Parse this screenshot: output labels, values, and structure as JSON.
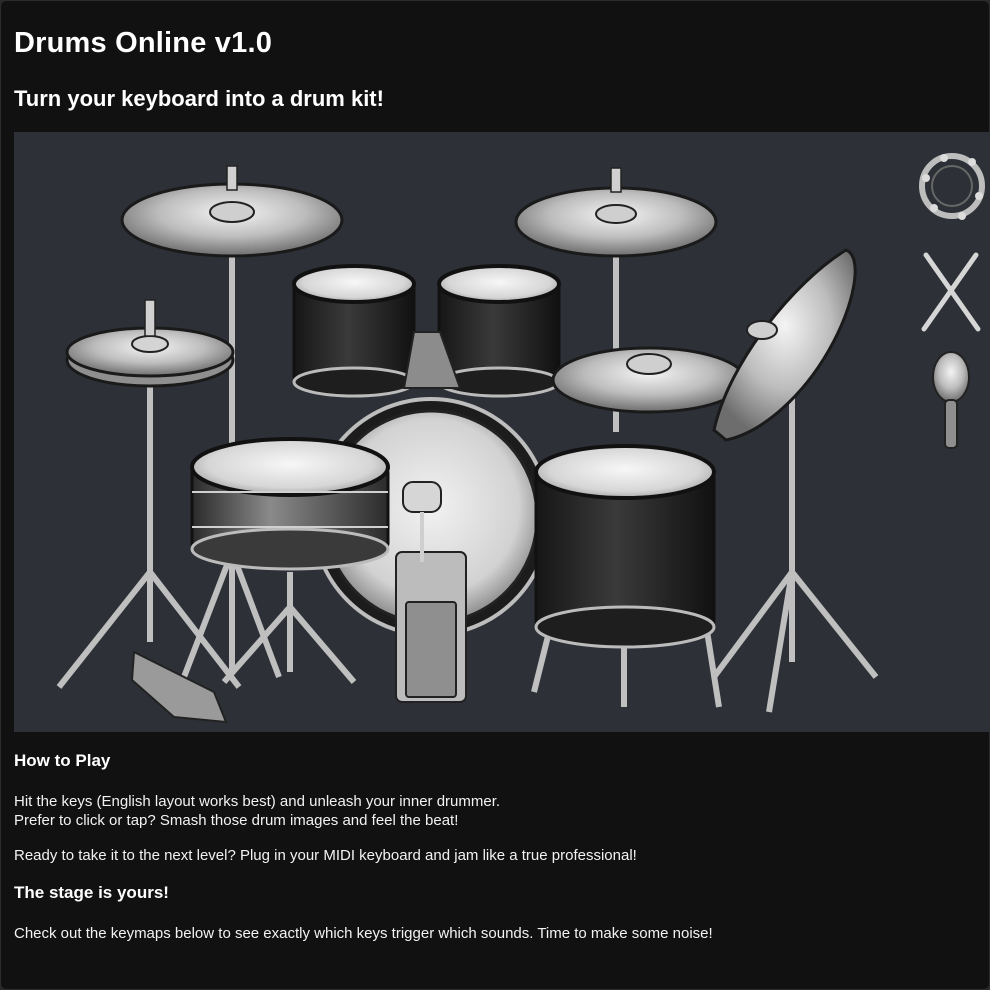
{
  "app": {
    "title": "Drums Online v1.0",
    "subtitle": "Turn your keyboard into a drum kit!"
  },
  "stage": {
    "background": "#2d3137",
    "pieces": [
      {
        "id": "crash-cymbal-left",
        "icon": "crash-cymbal"
      },
      {
        "id": "ride-cymbal",
        "icon": "ride-cymbal"
      },
      {
        "id": "hi-hat",
        "icon": "hi-hat"
      },
      {
        "id": "tom-1",
        "icon": "tom"
      },
      {
        "id": "tom-2",
        "icon": "tom"
      },
      {
        "id": "cowbell",
        "icon": "cowbell"
      },
      {
        "id": "bass-drum",
        "icon": "kick-drum"
      },
      {
        "id": "snare-drum",
        "icon": "snare"
      },
      {
        "id": "splash-cymbal",
        "icon": "splash-cymbal"
      },
      {
        "id": "floor-tom",
        "icon": "floor-tom"
      },
      {
        "id": "china-cymbal",
        "icon": "china-cymbal"
      },
      {
        "id": "tambourine",
        "icon": "tambourine"
      },
      {
        "id": "drumsticks",
        "icon": "drumsticks"
      },
      {
        "id": "maraca",
        "icon": "maraca"
      }
    ]
  },
  "how_to_play": {
    "heading": "How to Play",
    "line1": "Hit the keys (English layout works best) and unleash your inner drummer.",
    "line2": "Prefer to click or tap? Smash those drum images and feel the beat!",
    "midi": "Ready to take it to the next level? Plug in your MIDI keyboard and jam like a true professional!"
  },
  "stage_section": {
    "heading": "The stage is yours!",
    "body": "Check out the keymaps below to see exactly which keys trigger which sounds. Time to make some noise!"
  }
}
